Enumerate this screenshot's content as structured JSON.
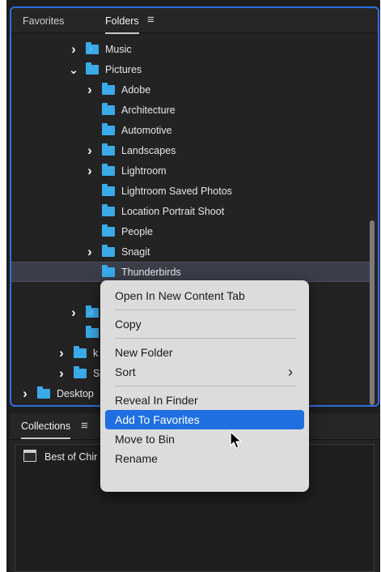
{
  "tabs": {
    "favorites": "Favorites",
    "folders": "Folders",
    "menu_glyph": "≡"
  },
  "folders": [
    {
      "label": "Music",
      "chevron": ">",
      "icon": "folder-music-icon"
    },
    {
      "label": "Pictures",
      "chevron": "v",
      "icon": "folder-pictures-icon"
    },
    {
      "label": "Adobe",
      "chevron": ">",
      "icon": "folder-icon"
    },
    {
      "label": "Architecture",
      "chevron": "",
      "icon": "folder-icon"
    },
    {
      "label": "Automotive",
      "chevron": "",
      "icon": "folder-icon"
    },
    {
      "label": "Landscapes",
      "chevron": ">",
      "icon": "folder-icon"
    },
    {
      "label": "Lightroom",
      "chevron": ">",
      "icon": "folder-icon"
    },
    {
      "label": "Lightroom Saved Photos",
      "chevron": "",
      "icon": "folder-icon"
    },
    {
      "label": "Location Portrait Shoot",
      "chevron": "",
      "icon": "folder-icon"
    },
    {
      "label": "People",
      "chevron": "",
      "icon": "folder-icon"
    },
    {
      "label": "Snagit",
      "chevron": ">",
      "icon": "folder-icon"
    },
    {
      "label": "Thunderbirds",
      "chevron": "",
      "icon": "folder-icon",
      "selected": true
    },
    {
      "label": "",
      "chevron": "",
      "icon": "folder-icon"
    },
    {
      "label": "",
      "chevron": ">",
      "icon": "folder-dev-icon"
    },
    {
      "label": "",
      "chevron": "",
      "icon": "folder-icon"
    },
    {
      "label": "k",
      "chevron": ">",
      "icon": "folder-icon"
    },
    {
      "label": "S",
      "chevron": ">",
      "icon": "folder-icon"
    },
    {
      "label": "Desktop",
      "chevron": ">",
      "icon": "folder-desktop-icon"
    }
  ],
  "collections": {
    "tab_label": "Collections",
    "menu_glyph": "≡",
    "items": [
      {
        "label": "Best of Chir",
        "icon": "collection-icon"
      }
    ]
  },
  "context_menu": {
    "items": [
      {
        "label": "Open In New Content Tab"
      },
      {
        "separator": true
      },
      {
        "label": "Copy"
      },
      {
        "separator": true
      },
      {
        "label": "New Folder"
      },
      {
        "label": "Sort",
        "submenu": true,
        "arrow": "›"
      },
      {
        "separator": true
      },
      {
        "label": "Reveal In Finder"
      },
      {
        "label": "Add To Favorites",
        "highlighted": true
      },
      {
        "label": "Move to Bin"
      },
      {
        "label": "Rename"
      }
    ]
  },
  "colors": {
    "accent": "#1f6fe0",
    "folder": "#3aaae8",
    "panel_border": "#2f6fe0",
    "menu_bg": "#dcdcdc"
  }
}
